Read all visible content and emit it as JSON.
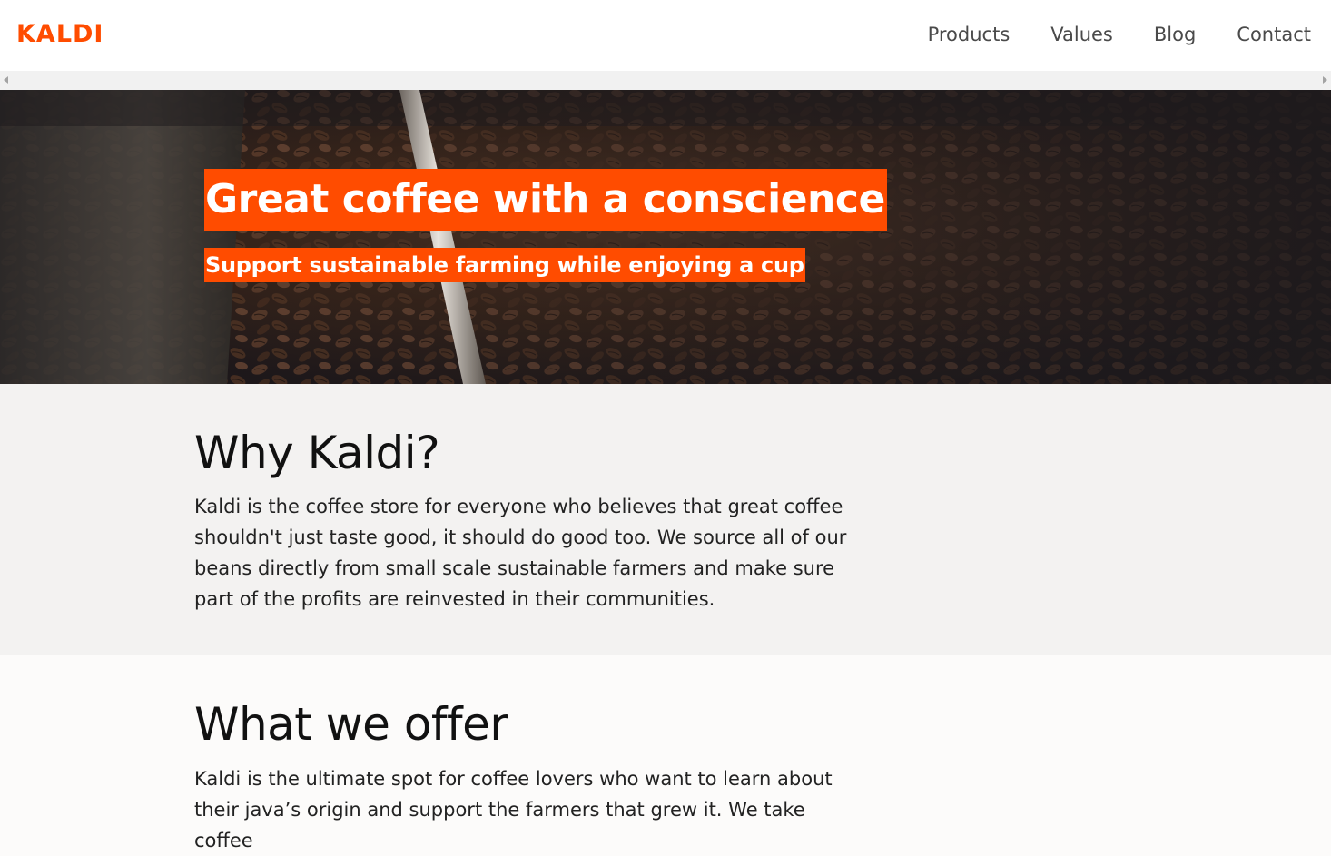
{
  "header": {
    "logo": "KALDI",
    "nav": [
      "Products",
      "Values",
      "Blog",
      "Contact"
    ]
  },
  "hero": {
    "title": "Great coffee with a conscience",
    "subtitle": "Support sustainable farming while enjoying a cup",
    "image_description_icon": "coffee-beans-roaster-photo"
  },
  "why": {
    "heading": "Why Kaldi?",
    "body": "Kaldi is the coffee store for everyone who believes that great coffee shouldn't just taste good, it should do good too. We source all of our beans directly from small scale sustainable farmers and make sure part of the profits are reinvested in their communities."
  },
  "offer": {
    "heading": "What we offer",
    "body": "Kaldi is the ultimate spot for coffee lovers who want to learn about their java’s origin and support the farmers that grew it. We take coffee"
  },
  "colors": {
    "accent": "#ff4c00",
    "header_bg": "#ffffff",
    "section_alt_bg": "#f3f2f1",
    "section_bg": "#fcfbfa",
    "nav_text": "#4a4a4a"
  }
}
